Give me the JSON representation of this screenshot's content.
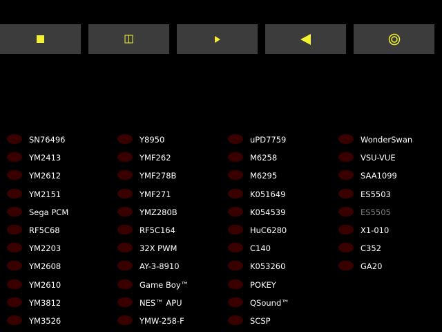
{
  "toolbar": {
    "buttons": [
      {
        "icon": "stop-icon"
      },
      {
        "icon": "pause-icon"
      },
      {
        "icon": "play-icon"
      },
      {
        "icon": "previous-icon"
      },
      {
        "icon": "target-icon"
      }
    ],
    "icon_color": "#f2f233",
    "button_color": "#3c3c3c"
  },
  "chips": {
    "led_off_color": "#3a0000",
    "columns": [
      [
        "SN76496",
        "YM2413",
        "YM2612",
        "YM2151",
        "Sega PCM",
        "RF5C68",
        "YM2203",
        "YM2608",
        "YM2610",
        "YM3812",
        "YM3526"
      ],
      [
        "Y8950",
        "YMF262",
        "YMF278B",
        "YMF271",
        "YMZ280B",
        "RF5C164",
        "32X PWM",
        "AY-3-8910",
        "Game Boy™",
        "NES™ APU",
        "YMW-258-F"
      ],
      [
        "uPD7759",
        "M6258",
        "M6295",
        "K051649",
        "K054539",
        "HuC6280",
        "C140",
        "K053260",
        "POKEY",
        "QSound™",
        "SCSP"
      ],
      [
        "WonderSwan",
        "VSU-VUE",
        "SAA1099",
        "ES5503",
        "ES5505",
        "X1-010",
        "C352",
        "GA20"
      ]
    ],
    "disabled": [
      "ES5505"
    ]
  }
}
